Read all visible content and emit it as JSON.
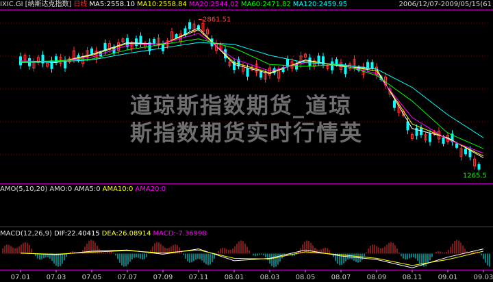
{
  "header": {
    "symbol": "IXIC.GI",
    "name": "[纳斯达克指数]",
    "period": "日线",
    "ma5": "MA5:2558.10",
    "ma10": "MA10:2558.84",
    "ma20": "MA20:2544.02",
    "ma60": "MA60:2471.82",
    "ma120": "MA120:2459.95",
    "date_range": "2006/12/07-2009/05/15(61"
  },
  "amo_header": {
    "label": "AMO(5,10,20)",
    "amo": "AMO:0",
    "amo5": "AMA5:0",
    "amo10": "AMA10:0",
    "amo20": "AMA20:0"
  },
  "macd_header": {
    "label": "MACD(12,26,9)",
    "dif": "DIF:22.40415",
    "dea": "DEA:26.08914",
    "macd": "MACD:-7.36998"
  },
  "price_labels": {
    "high": "2861.51",
    "low": "1265.5"
  },
  "watermark": "道琼斯指数期货_道琼斯指数期货实时行情英",
  "x_ticks": [
    "07.01",
    "07.03",
    "07.05",
    "07.07",
    "07.09",
    "07.11",
    "08.01",
    "08.03",
    "08.05",
    "08.07",
    "08.09",
    "08.11",
    "09.01",
    "09.03"
  ],
  "colors": {
    "ma5": "#ffffff",
    "ma10": "#ffff00",
    "ma20": "#ff00ff",
    "ma60": "#00ff00",
    "ma120": "#00ffff",
    "up": "#ff3030",
    "down": "#00ffff",
    "grid": "#800000",
    "divider": "#c000c0"
  },
  "chart_data": {
    "type": "line",
    "title": "",
    "x": [
      "07.01",
      "07.03",
      "07.05",
      "07.07",
      "07.09",
      "07.11",
      "08.01",
      "08.03",
      "08.05",
      "08.07",
      "08.09",
      "08.11",
      "09.01",
      "09.03"
    ],
    "ylim": [
      1100,
      3000
    ],
    "series": [
      {
        "name": "MA5",
        "values": [
          2440,
          2420,
          2510,
          2640,
          2620,
          2800,
          2400,
          2300,
          2450,
          2380,
          2350,
          1700,
          1600,
          1380
        ]
      },
      {
        "name": "MA10",
        "values": [
          2440,
          2425,
          2500,
          2630,
          2625,
          2780,
          2420,
          2310,
          2440,
          2390,
          2330,
          1750,
          1590,
          1400
        ]
      },
      {
        "name": "MA20",
        "values": [
          2440,
          2430,
          2480,
          2610,
          2630,
          2740,
          2460,
          2330,
          2420,
          2400,
          2300,
          1820,
          1580,
          1430
        ]
      },
      {
        "name": "MA60",
        "values": [
          2430,
          2440,
          2460,
          2560,
          2620,
          2680,
          2580,
          2400,
          2380,
          2400,
          2280,
          2000,
          1650,
          1480
        ]
      },
      {
        "name": "MA120",
        "values": [
          2420,
          2430,
          2450,
          2520,
          2580,
          2640,
          2620,
          2500,
          2420,
          2400,
          2350,
          2150,
          1850,
          1600
        ]
      }
    ],
    "close": [
      2440,
      2420,
      2510,
      2640,
      2620,
      2840,
      2390,
      2290,
      2460,
      2380,
      2360,
      1650,
      1600,
      1270
    ],
    "macd_dif": [
      5,
      -10,
      20,
      30,
      -5,
      40,
      -60,
      -40,
      30,
      -20,
      -50,
      -120,
      -30,
      40
    ],
    "macd_dea": [
      3,
      -5,
      12,
      25,
      5,
      30,
      -40,
      -45,
      15,
      -10,
      -40,
      -100,
      -50,
      20
    ]
  }
}
